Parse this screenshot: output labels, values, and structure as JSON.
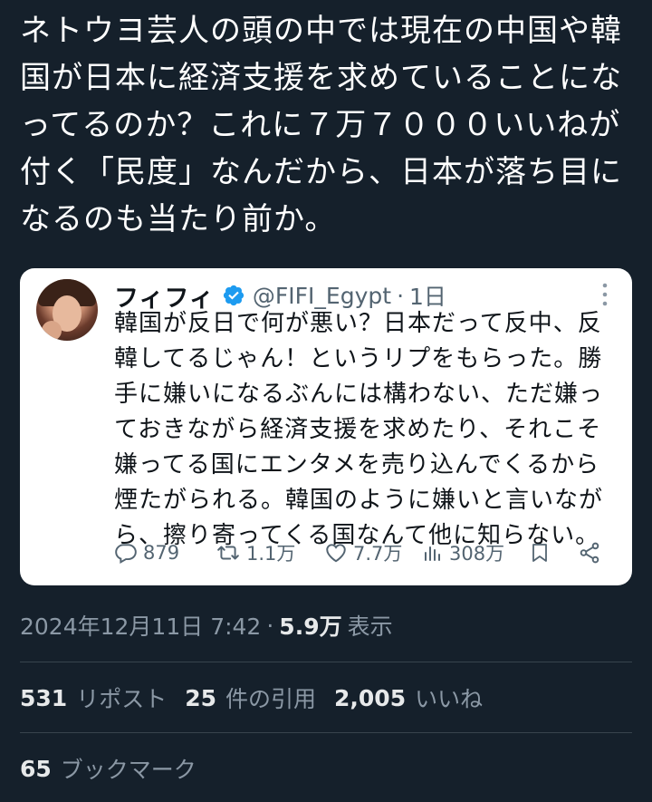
{
  "tweet": {
    "text": "ネトウヨ芸人の頭の中では現在の中国や韓国が日本に経済支援を求めていることになってるのか？これに７万７０００いいねが付く「民度」なんだから、日本が落ち目になるのも当たり前か。"
  },
  "quote": {
    "name": "フィフィ",
    "handle": "@FIFI_Egypt",
    "dot": "·",
    "time": "1日",
    "text": "韓国が反日で何が悪い？日本だって反中、反韓してるじゃん！というリプをもらった。勝手に嫌いになるぶんには構わない、ただ嫌っておきながら経済支援を求めたり、それこそ嫌ってる国にエンタメを売り込んでくるから煙たがられる。韓国のように嫌いと言いながら、擦り寄ってくる国なんて他に知らない。",
    "replies": "879",
    "retweets": "1.1万",
    "likes": "7.7万",
    "views": "308万",
    "verified_color": "#1d9bf0"
  },
  "meta": {
    "datetime": "2024年12月11日 7:42",
    "dot": "·",
    "views_count": "5.9万",
    "views_label": "表示"
  },
  "stats": {
    "reposts_count": "531",
    "reposts_label": "リポスト",
    "quotes_count": "25",
    "quotes_label": "件の引用",
    "likes_count": "2,005",
    "likes_label": "いいね",
    "bookmarks_count": "65",
    "bookmarks_label": "ブックマーク"
  },
  "icons": {
    "verified": "verified-badge-icon",
    "more": "more-options-icon",
    "reply": "reply-icon",
    "retweet": "retweet-icon",
    "like": "heart-icon",
    "views": "views-chart-icon",
    "bookmark": "bookmark-icon",
    "share": "share-icon"
  }
}
